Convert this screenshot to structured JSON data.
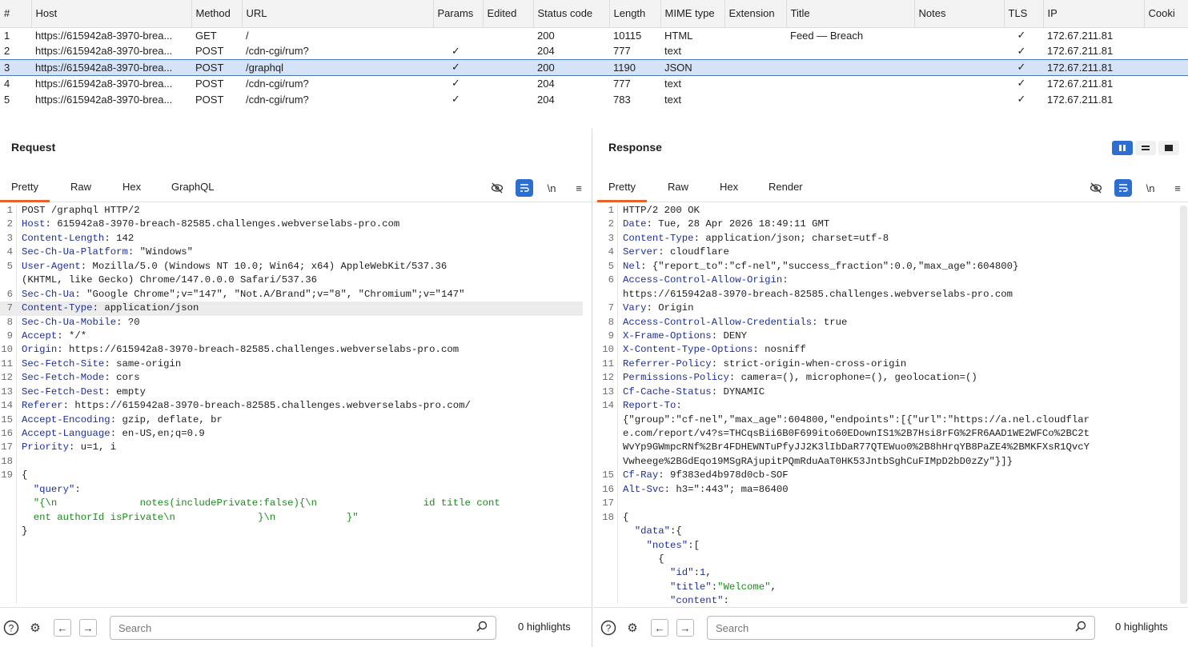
{
  "history": {
    "columns": [
      "#",
      "Host",
      "Method",
      "URL",
      "Params",
      "Edited",
      "Status code",
      "Length",
      "MIME type",
      "Extension",
      "Title",
      "Notes",
      "TLS",
      "IP",
      "Cooki"
    ],
    "rows": [
      {
        "num": "1",
        "host": "https://615942a8-3970-brea...",
        "method": "GET",
        "url": "/",
        "params": "",
        "edited": "",
        "status": "200",
        "length": "10115",
        "mime": "HTML",
        "ext": "",
        "title": "Feed — Breach",
        "notes": "",
        "tls": "✓",
        "ip": "172.67.211.81",
        "cookies": ""
      },
      {
        "num": "2",
        "host": "https://615942a8-3970-brea...",
        "method": "POST",
        "url": "/cdn-cgi/rum?",
        "params": "✓",
        "edited": "",
        "status": "204",
        "length": "777",
        "mime": "text",
        "ext": "",
        "title": "",
        "notes": "",
        "tls": "✓",
        "ip": "172.67.211.81",
        "cookies": ""
      },
      {
        "num": "3",
        "host": "https://615942a8-3970-brea...",
        "method": "POST",
        "url": "/graphql",
        "params": "✓",
        "edited": "",
        "status": "200",
        "length": "1190",
        "mime": "JSON",
        "ext": "",
        "title": "",
        "notes": "",
        "tls": "✓",
        "ip": "172.67.211.81",
        "cookies": "",
        "selected": true
      },
      {
        "num": "4",
        "host": "https://615942a8-3970-brea...",
        "method": "POST",
        "url": "/cdn-cgi/rum?",
        "params": "✓",
        "edited": "",
        "status": "204",
        "length": "777",
        "mime": "text",
        "ext": "",
        "title": "",
        "notes": "",
        "tls": "✓",
        "ip": "172.67.211.81",
        "cookies": ""
      },
      {
        "num": "5",
        "host": "https://615942a8-3970-brea...",
        "method": "POST",
        "url": "/cdn-cgi/rum?",
        "params": "✓",
        "edited": "",
        "status": "204",
        "length": "783",
        "mime": "text",
        "ext": "",
        "title": "",
        "notes": "",
        "tls": "✓",
        "ip": "172.67.211.81",
        "cookies": ""
      }
    ]
  },
  "request": {
    "title": "Request",
    "tabs": [
      "Pretty",
      "Raw",
      "Hex",
      "GraphQL"
    ],
    "active_tab": "Pretty",
    "newline_toggle": "\\n",
    "lines": [
      {
        "n": "1",
        "parts": [
          [
            "",
            "POST /graphql HTTP/2"
          ]
        ]
      },
      {
        "n": "2",
        "parts": [
          [
            "hk",
            "Host"
          ],
          [
            "",
            ": 615942a8-3970-breach-82585.challenges.webverselabs-pro.com"
          ]
        ]
      },
      {
        "n": "3",
        "parts": [
          [
            "hk",
            "Content-Length"
          ],
          [
            "",
            ": 142"
          ]
        ]
      },
      {
        "n": "4",
        "parts": [
          [
            "hk",
            "Sec-Ch-Ua-Platform"
          ],
          [
            "",
            ": \"Windows\""
          ]
        ]
      },
      {
        "n": "5",
        "parts": [
          [
            "hk",
            "User-Agent"
          ],
          [
            "",
            ": Mozilla/5.0 (Windows NT 10.0; Win64; x64) AppleWebKit/537.36"
          ]
        ]
      },
      {
        "n": "",
        "parts": [
          [
            "",
            "(KHTML, like Gecko) Chrome/147.0.0.0 Safari/537.36"
          ]
        ]
      },
      {
        "n": "6",
        "parts": [
          [
            "hk",
            "Sec-Ch-Ua"
          ],
          [
            "",
            ": \"Google Chrome\";v=\"147\", \"Not.A/Brand\";v=\"8\", \"Chromium\";v=\"147\""
          ]
        ]
      },
      {
        "n": "7",
        "parts": [
          [
            "hk",
            "Content-Type"
          ],
          [
            "",
            ": application/json"
          ]
        ],
        "hl": true
      },
      {
        "n": "8",
        "parts": [
          [
            "hk",
            "Sec-Ch-Ua-Mobile"
          ],
          [
            "",
            ": ?0"
          ]
        ]
      },
      {
        "n": "9",
        "parts": [
          [
            "hk",
            "Accept"
          ],
          [
            "",
            ": */*"
          ]
        ]
      },
      {
        "n": "10",
        "parts": [
          [
            "hk",
            "Origin"
          ],
          [
            "",
            ": https://615942a8-3970-breach-82585.challenges.webverselabs-pro.com"
          ]
        ]
      },
      {
        "n": "11",
        "parts": [
          [
            "hk",
            "Sec-Fetch-Site"
          ],
          [
            "",
            ": same-origin"
          ]
        ]
      },
      {
        "n": "12",
        "parts": [
          [
            "hk",
            "Sec-Fetch-Mode"
          ],
          [
            "",
            ": cors"
          ]
        ]
      },
      {
        "n": "13",
        "parts": [
          [
            "hk",
            "Sec-Fetch-Dest"
          ],
          [
            "",
            ": empty"
          ]
        ]
      },
      {
        "n": "14",
        "parts": [
          [
            "hk",
            "Referer"
          ],
          [
            "",
            ": https://615942a8-3970-breach-82585.challenges.webverselabs-pro.com/"
          ]
        ]
      },
      {
        "n": "15",
        "parts": [
          [
            "hk",
            "Accept-Encoding"
          ],
          [
            "",
            ": gzip, deflate, br"
          ]
        ]
      },
      {
        "n": "16",
        "parts": [
          [
            "hk",
            "Accept-Language"
          ],
          [
            "",
            ": en-US,en;q=0.9"
          ]
        ]
      },
      {
        "n": "17",
        "parts": [
          [
            "hk",
            "Priority"
          ],
          [
            "",
            ": u=1, i"
          ]
        ]
      },
      {
        "n": "18",
        "parts": [
          [
            "",
            ""
          ]
        ]
      },
      {
        "n": "19",
        "parts": [
          [
            "",
            "{"
          ]
        ]
      },
      {
        "n": "",
        "parts": [
          [
            "jk",
            "  \"query\""
          ],
          [
            "",
            ":"
          ]
        ]
      },
      {
        "n": "",
        "parts": [
          [
            "js",
            "  \"{\\n              notes(includePrivate:false){\\n                  id title cont"
          ]
        ]
      },
      {
        "n": "",
        "parts": [
          [
            "js",
            "  ent authorId isPrivate\\n              }\\n            }\""
          ]
        ]
      },
      {
        "n": "",
        "parts": [
          [
            "",
            "}"
          ]
        ]
      }
    ]
  },
  "response": {
    "title": "Response",
    "tabs": [
      "Pretty",
      "Raw",
      "Hex",
      "Render"
    ],
    "active_tab": "Pretty",
    "newline_toggle": "\\n",
    "lines": [
      {
        "n": "1",
        "parts": [
          [
            "",
            "HTTP/2 200 OK"
          ]
        ]
      },
      {
        "n": "2",
        "parts": [
          [
            "hk",
            "Date"
          ],
          [
            "",
            ": Tue, 28 Apr 2026 18:49:11 GMT"
          ]
        ]
      },
      {
        "n": "3",
        "parts": [
          [
            "hk",
            "Content-Type"
          ],
          [
            "",
            ": application/json; charset=utf-8"
          ]
        ]
      },
      {
        "n": "4",
        "parts": [
          [
            "hk",
            "Server"
          ],
          [
            "",
            ": cloudflare"
          ]
        ]
      },
      {
        "n": "5",
        "parts": [
          [
            "hk",
            "Nel"
          ],
          [
            "",
            ": {\"report_to\":\"cf-nel\",\"success_fraction\":0.0,\"max_age\":604800}"
          ]
        ]
      },
      {
        "n": "6",
        "parts": [
          [
            "hk",
            "Access-Control-Allow-Origin"
          ],
          [
            "",
            ":"
          ]
        ]
      },
      {
        "n": "",
        "parts": [
          [
            "",
            "https://615942a8-3970-breach-82585.challenges.webverselabs-pro.com"
          ]
        ]
      },
      {
        "n": "7",
        "parts": [
          [
            "hk",
            "Vary"
          ],
          [
            "",
            ": Origin"
          ]
        ]
      },
      {
        "n": "8",
        "parts": [
          [
            "hk",
            "Access-Control-Allow-Credentials"
          ],
          [
            "",
            ": true"
          ]
        ]
      },
      {
        "n": "9",
        "parts": [
          [
            "hk",
            "X-Frame-Options"
          ],
          [
            "",
            ": DENY"
          ]
        ]
      },
      {
        "n": "10",
        "parts": [
          [
            "hk",
            "X-Content-Type-Options"
          ],
          [
            "",
            ": nosniff"
          ]
        ]
      },
      {
        "n": "11",
        "parts": [
          [
            "hk",
            "Referrer-Policy"
          ],
          [
            "",
            ": strict-origin-when-cross-origin"
          ]
        ]
      },
      {
        "n": "12",
        "parts": [
          [
            "hk",
            "Permissions-Policy"
          ],
          [
            "",
            ": camera=(), microphone=(), geolocation=()"
          ]
        ]
      },
      {
        "n": "13",
        "parts": [
          [
            "hk",
            "Cf-Cache-Status"
          ],
          [
            "",
            ": DYNAMIC"
          ]
        ]
      },
      {
        "n": "14",
        "parts": [
          [
            "hk",
            "Report-To"
          ],
          [
            "",
            ":"
          ]
        ]
      },
      {
        "n": "",
        "parts": [
          [
            "",
            "{\"group\":\"cf-nel\",\"max_age\":604800,\"endpoints\":[{\"url\":\"https://a.nel.cloudflar"
          ]
        ]
      },
      {
        "n": "",
        "parts": [
          [
            "",
            "e.com/report/v4?s=THCqsBii6B0F699ito60EDownIS1%2B7Hsi8rFG%2FR6AAD1WE2WFCo%2BC2t"
          ]
        ]
      },
      {
        "n": "",
        "parts": [
          [
            "",
            "WvYp9GWmpcRNf%2Br4FDHEWNTuPfyJJ2K3lIbDaR77QTEWuo0%2B8hHrqYB8PaZE4%2BMKFXsR1QvcY"
          ]
        ]
      },
      {
        "n": "",
        "parts": [
          [
            "",
            "Vwheege%2BGdEqo19MSgRAjupitPQmRduAaT0HK53JntbSghCuFIMpD2bD0zZy\"}]}"
          ]
        ]
      },
      {
        "n": "15",
        "parts": [
          [
            "hk",
            "Cf-Ray"
          ],
          [
            "",
            ": 9f383ed4b978d0cb-SOF"
          ]
        ]
      },
      {
        "n": "16",
        "parts": [
          [
            "hk",
            "Alt-Svc"
          ],
          [
            "",
            ": h3=\":443\"; ma=86400"
          ]
        ]
      },
      {
        "n": "17",
        "parts": [
          [
            "",
            ""
          ]
        ]
      },
      {
        "n": "18",
        "parts": [
          [
            "",
            "{"
          ]
        ]
      },
      {
        "n": "",
        "parts": [
          [
            "jk",
            "  \"data\""
          ],
          [
            "",
            ":{"
          ]
        ]
      },
      {
        "n": "",
        "parts": [
          [
            "jk",
            "    \"notes\""
          ],
          [
            "",
            ":["
          ]
        ]
      },
      {
        "n": "",
        "parts": [
          [
            "",
            "      {"
          ]
        ]
      },
      {
        "n": "",
        "parts": [
          [
            "jk",
            "        \"id\""
          ],
          [
            "",
            ":"
          ],
          [
            "jn",
            "1"
          ],
          [
            "",
            ","
          ]
        ]
      },
      {
        "n": "",
        "parts": [
          [
            "jk",
            "        \"title\""
          ],
          [
            "",
            ":"
          ],
          [
            "js",
            "\"Welcome\""
          ],
          [
            "",
            ","
          ]
        ]
      },
      {
        "n": "",
        "parts": [
          [
            "jk",
            "        \"content\""
          ],
          [
            "",
            ":"
          ]
        ]
      }
    ]
  },
  "bottom": {
    "search_placeholder": "Search",
    "highlights": "0 highlights"
  }
}
